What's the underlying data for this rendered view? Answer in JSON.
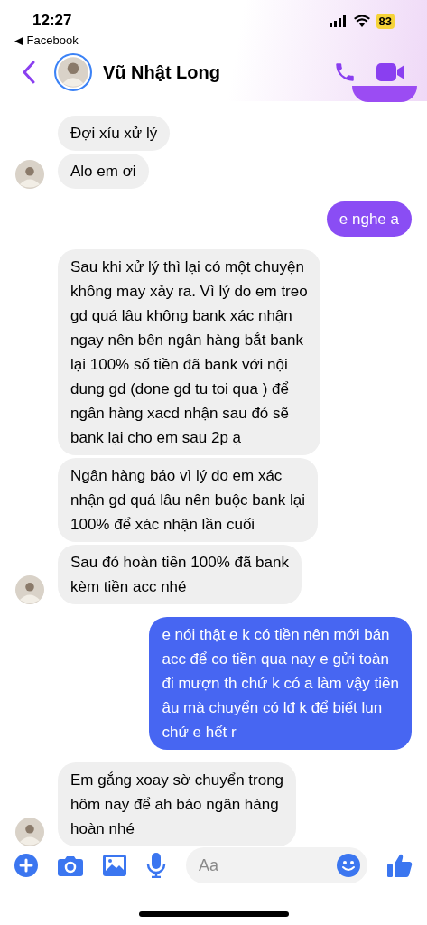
{
  "status_bar": {
    "time": "12:27",
    "back_app": "◀ Facebook",
    "battery": "83"
  },
  "header": {
    "name": "Vũ Nhật Long"
  },
  "messages": [
    {
      "kind": "peek",
      "color": "#9b4cf3"
    },
    {
      "kind": "incoming",
      "text": "Đợi xíu xử lý",
      "avatar": false
    },
    {
      "kind": "incoming",
      "text": "Alo em ơi",
      "avatar": true
    },
    {
      "kind": "outgoing",
      "text": "e nghe a",
      "color": "#8a4df4"
    },
    {
      "kind": "incoming",
      "text": "Sau khi xử lý thì lại có một chuyện\nkhông may xảy ra. Vì lý do em treo\ngd quá lâu không bank xác nhận\nngay nên bên ngân hàng bắt bank\nlại 100% số tiền đã bank với nội\ndung gd (done gd tu toi qua ) để\nngân hàng xacd nhận sau đó sẽ\nbank lại cho em sau 2p ạ",
      "avatar": false
    },
    {
      "kind": "incoming",
      "text": "Ngân hàng báo vì lý do em xác\nnhận gd quá lâu nên buộc bank lại\n100% để xác nhận lần cuối",
      "avatar": false
    },
    {
      "kind": "incoming",
      "text": "Sau đó hoàn tiền 100% đã bank\nkèm tiền acc nhé",
      "avatar": true
    },
    {
      "kind": "outgoing",
      "text": "e nói thật e k có tiền nên mới bán\nacc để co tiền qua nay e gửi toàn\nđi mượn th chứ k có a làm vậy tiền\nâu mà chuyển có lđ k để biết lun\nchứ e hết r",
      "color": "#4766f2"
    },
    {
      "kind": "incoming",
      "text": "Em gắng xoay sờ chuyển trong\nhôm nay để ah báo ngân hàng\nhoàn nhé",
      "avatar": true
    }
  ],
  "composer": {
    "placeholder": "Aa"
  }
}
